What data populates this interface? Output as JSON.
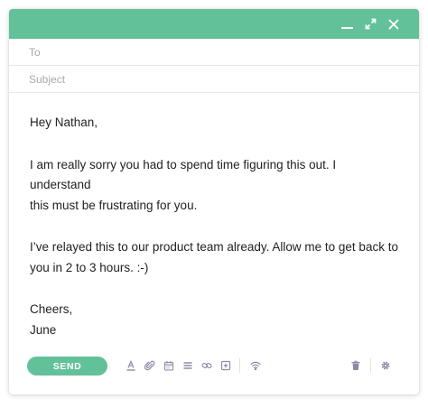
{
  "window": {
    "controls": [
      "minimize-icon",
      "expand-icon",
      "close-icon"
    ],
    "accent_color": "#63c19a"
  },
  "compose": {
    "to_placeholder": "To",
    "subject_placeholder": "Subject",
    "greeting": "Hey Nathan,",
    "paragraph1_line1": "I am really sorry you had to spend time figuring this out. I understand",
    "paragraph1_line2": "this must be frustrating for you.",
    "paragraph2_line1": "I’ve relayed this to our product team already. Allow me to get back to",
    "paragraph2_line2": "you in 2 to 3 hours. :-)",
    "signoff": "Cheers,",
    "signature": "June"
  },
  "toolbar": {
    "send_label": "SEND",
    "icons": [
      "text-format-icon",
      "attachment-icon",
      "calendar-icon",
      "list-icon",
      "link-icon",
      "add-box-icon",
      "wifi-icon",
      "trash-icon",
      "gear-icon"
    ]
  }
}
